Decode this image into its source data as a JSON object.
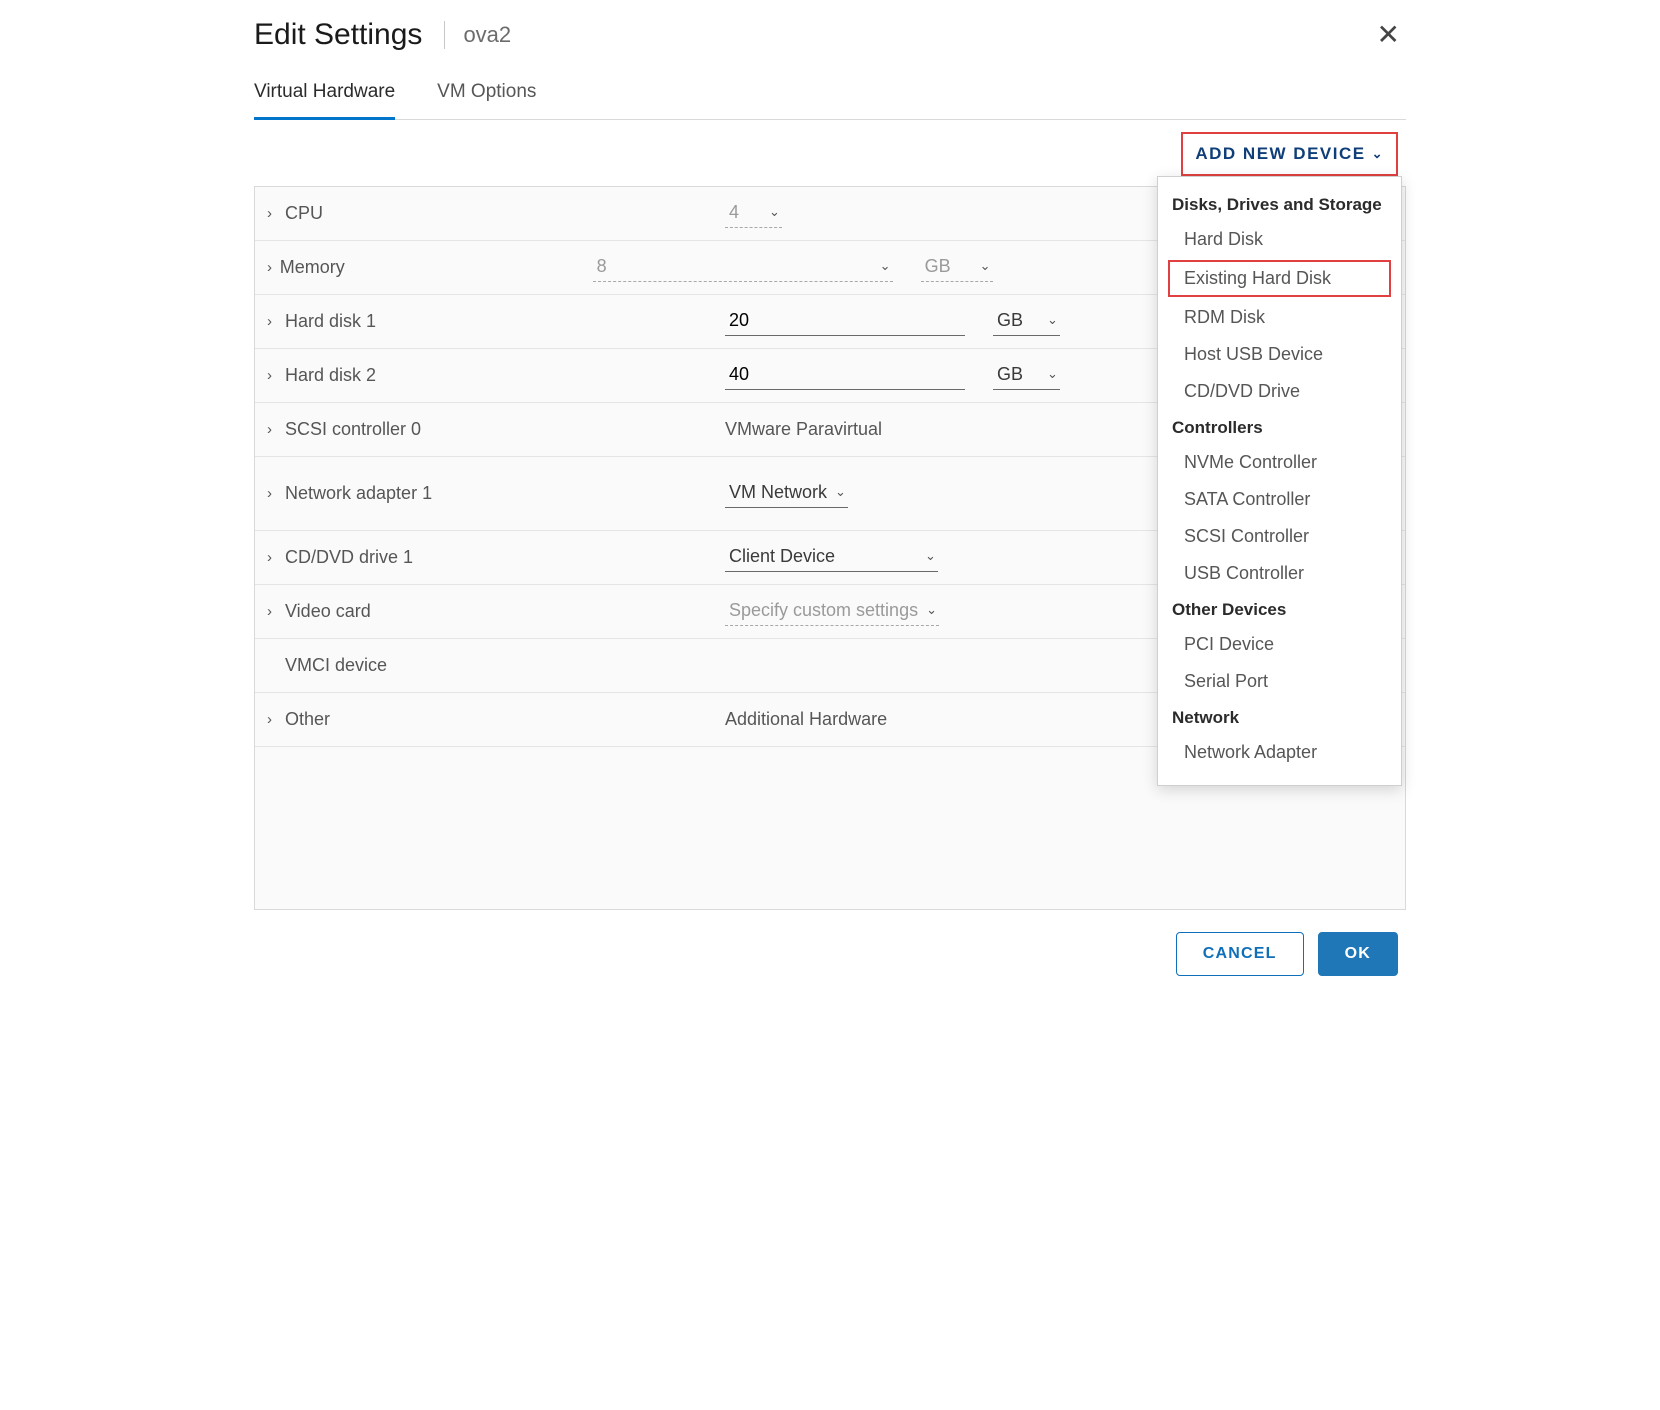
{
  "header": {
    "title": "Edit Settings",
    "subtitle": "ova2"
  },
  "tabs": {
    "virtual_hardware": "Virtual Hardware",
    "vm_options": "VM Options"
  },
  "toolbar": {
    "add_device_label": "ADD NEW DEVICE"
  },
  "rows": {
    "cpu": {
      "label": "CPU",
      "value": "4"
    },
    "memory": {
      "label": "Memory",
      "value": "8",
      "unit": "GB"
    },
    "hd1": {
      "label": "Hard disk 1",
      "value": "20",
      "unit": "GB"
    },
    "hd2": {
      "label": "Hard disk 2",
      "value": "40",
      "unit": "GB"
    },
    "scsi": {
      "label": "SCSI controller 0",
      "value": "VMware Paravirtual"
    },
    "net": {
      "label": "Network adapter 1",
      "value": "VM Network"
    },
    "cddvd": {
      "label": "CD/DVD drive 1",
      "value": "Client Device"
    },
    "video": {
      "label": "Video card",
      "value": "Specify custom settings"
    },
    "vmci": {
      "label": "VMCI device"
    },
    "other": {
      "label": "Other",
      "value": "Additional Hardware"
    }
  },
  "dropdown": {
    "section1": "Disks, Drives and Storage",
    "s1_i1": "Hard Disk",
    "s1_i2": "Existing Hard Disk",
    "s1_i3": "RDM Disk",
    "s1_i4": "Host USB Device",
    "s1_i5": "CD/DVD Drive",
    "section2": "Controllers",
    "s2_i1": "NVMe Controller",
    "s2_i2": "SATA Controller",
    "s2_i3": "SCSI Controller",
    "s2_i4": "USB Controller",
    "section3": "Other Devices",
    "s3_i1": "PCI Device",
    "s3_i2": "Serial Port",
    "section4": "Network",
    "s4_i1": "Network Adapter"
  },
  "footer": {
    "cancel": "CANCEL",
    "ok": "OK"
  }
}
